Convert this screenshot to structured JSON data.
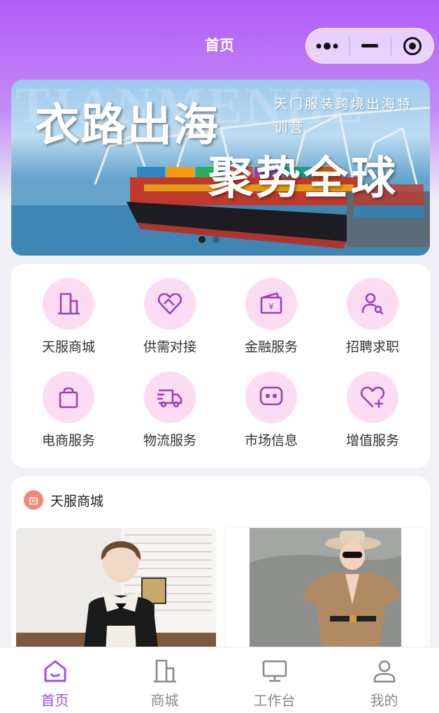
{
  "header": {
    "title": "首页",
    "capsule": {
      "more_icon": "more-dots-icon",
      "minimize_icon": "minimize-icon",
      "close_icon": "target-circle-icon"
    }
  },
  "banner": {
    "bg_text": "TIANMENHE",
    "title_line1": "衣路出海",
    "title_line2": "聚势全球",
    "subtitle": "天门服装跨境出海特训营",
    "dots": 2,
    "active_dot": 0
  },
  "services": [
    {
      "label": "天服商城",
      "icon": "building-icon"
    },
    {
      "label": "供需对接",
      "icon": "heart-link-icon"
    },
    {
      "label": "金融服务",
      "icon": "wallet-yen-icon"
    },
    {
      "label": "招聘求职",
      "icon": "user-search-icon"
    },
    {
      "label": "电商服务",
      "icon": "shopping-bag-icon"
    },
    {
      "label": "物流服务",
      "icon": "truck-icon"
    },
    {
      "label": "市场信息",
      "icon": "chat-bubble-icon"
    },
    {
      "label": "增值服务",
      "icon": "heart-plus-icon"
    }
  ],
  "mall": {
    "title": "天服商城",
    "products": [
      {
        "name": "black-white-dress-product"
      },
      {
        "name": "khaki-cape-dress-product"
      }
    ]
  },
  "tabbar": {
    "active": 0,
    "tabs": [
      {
        "label": "首页",
        "icon": "home-icon"
      },
      {
        "label": "商城",
        "icon": "building-icon"
      },
      {
        "label": "工作台",
        "icon": "monitor-icon"
      },
      {
        "label": "我的",
        "icon": "user-icon"
      }
    ]
  },
  "colors": {
    "accent": "#a050e0",
    "icon_bg": "#fbdcf2",
    "header": "#b05cf7"
  }
}
